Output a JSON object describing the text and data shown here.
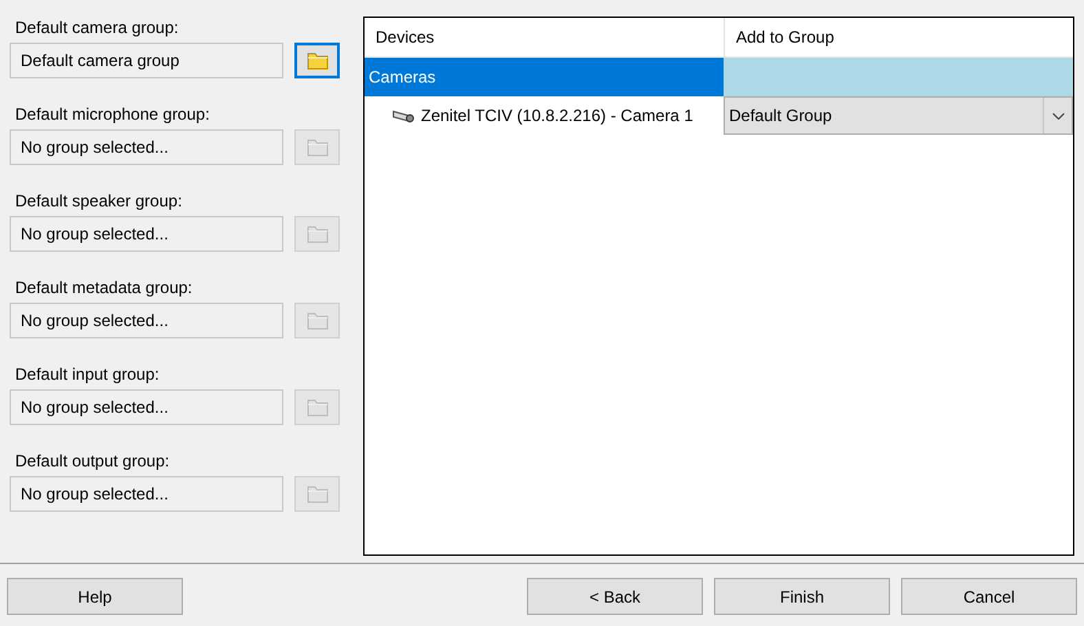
{
  "groups": [
    {
      "label": "Default camera group:",
      "value": "Default camera group",
      "disabled": false,
      "focused": true
    },
    {
      "label": "Default microphone group:",
      "value": "No group selected...",
      "disabled": true,
      "focused": false
    },
    {
      "label": "Default speaker group:",
      "value": "No group selected...",
      "disabled": true,
      "focused": false
    },
    {
      "label": "Default metadata group:",
      "value": "No group selected...",
      "disabled": true,
      "focused": false
    },
    {
      "label": "Default input group:",
      "value": "No group selected...",
      "disabled": true,
      "focused": false
    },
    {
      "label": "Default output group:",
      "value": "No group selected...",
      "disabled": true,
      "focused": false
    }
  ],
  "table": {
    "columns": [
      "Devices",
      "Add to Group"
    ],
    "rows": [
      {
        "kind": "category",
        "name": "Cameras",
        "selected": true
      },
      {
        "kind": "device",
        "name": "Zenitel TCIV (10.8.2.216) - Camera 1",
        "group": "Default Group",
        "selected": false
      }
    ]
  },
  "help_button": {
    "label": "Help"
  },
  "nav_buttons": [
    {
      "label": "< Back"
    },
    {
      "label": "Finish"
    },
    {
      "label": "Cancel"
    }
  ]
}
